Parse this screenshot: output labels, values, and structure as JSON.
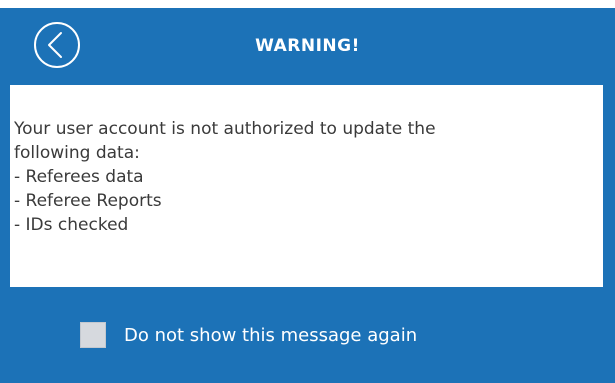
{
  "dialog": {
    "title": "WARNING!",
    "back_icon": "chevron-left-circle-icon",
    "colors": {
      "background": "#1c72b7",
      "message_background": "#ffffff",
      "text_on_blue": "#ffffff",
      "message_text": "#3a3a3a",
      "checkbox_fill": "#d6d9de"
    },
    "message": {
      "lines": [
        "Your user account is not authorized to update the",
        "following data:",
        "- Referees data",
        "- Referee Reports",
        "- IDs checked"
      ]
    },
    "footer": {
      "checkbox_checked": false,
      "checkbox_label": "Do not show this message again"
    }
  }
}
